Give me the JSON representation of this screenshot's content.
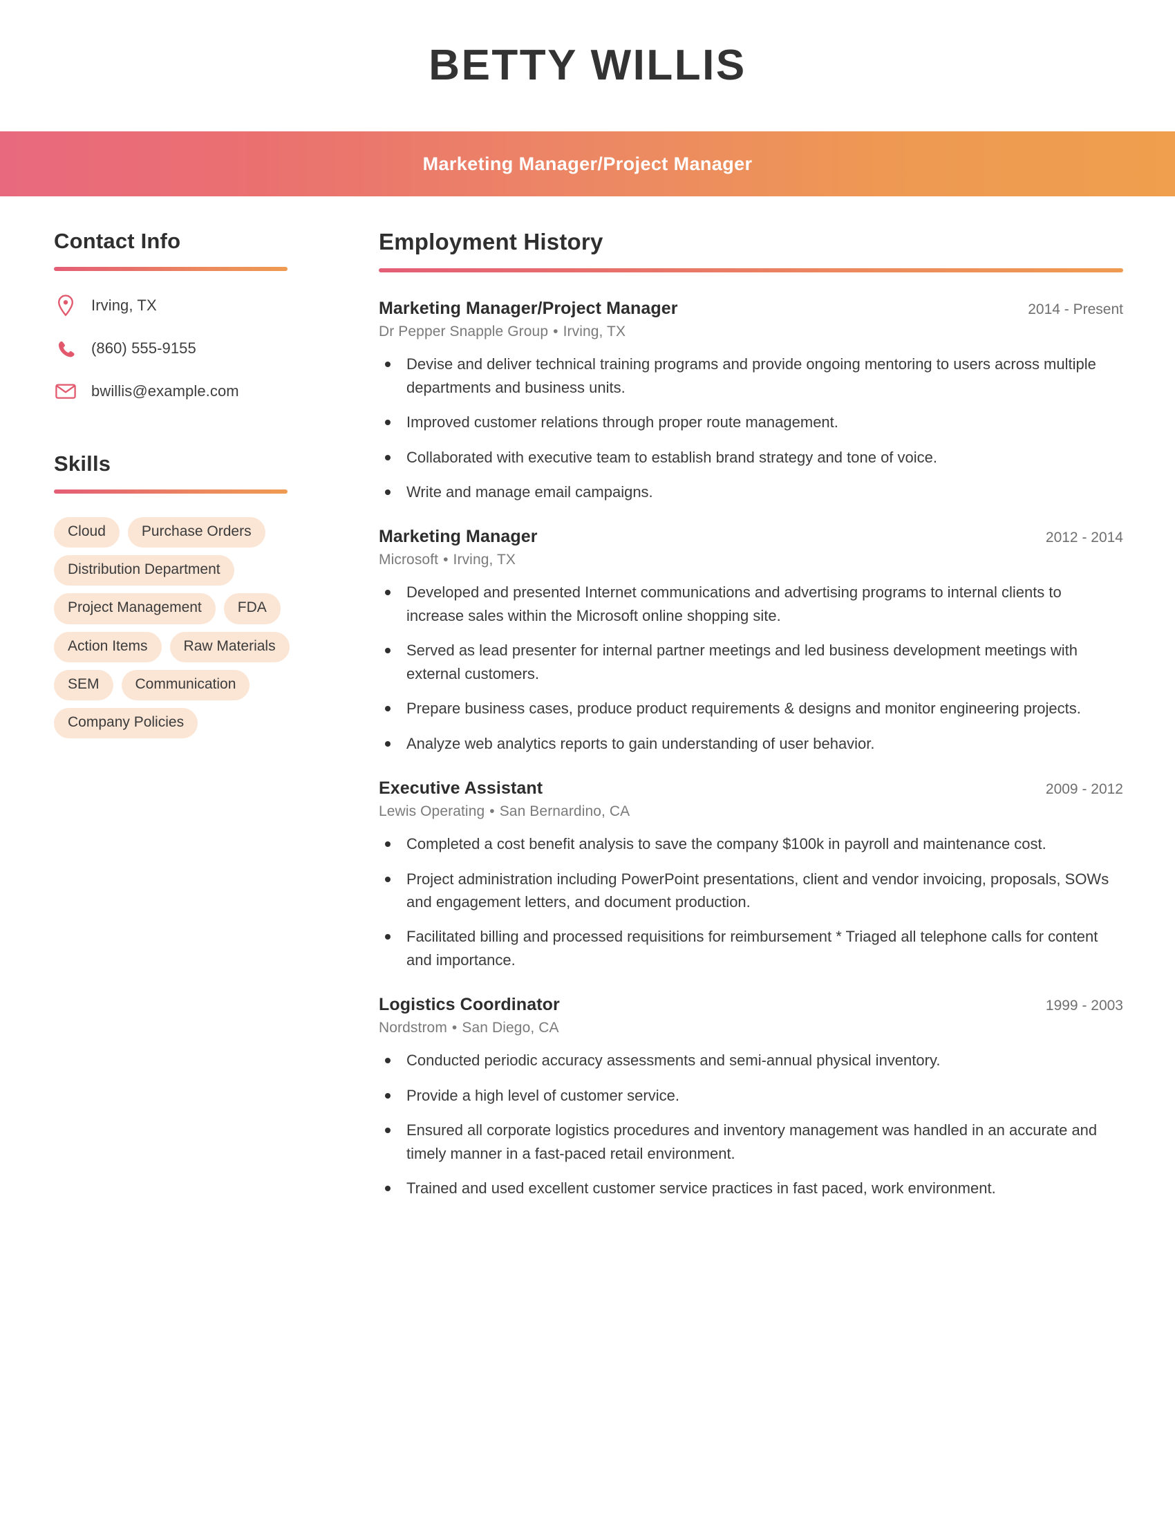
{
  "header": {
    "name": "BETTY WILLIS",
    "subtitle": "Marketing Manager/Project Manager",
    "gradient_start": "#E8697E",
    "gradient_end": "#EF9F4E",
    "name_color": "#333333",
    "subtitle_color": "#FFFFFF"
  },
  "sidebar": {
    "contact": {
      "heading": "Contact Info",
      "items": [
        {
          "icon": "location-pin-icon",
          "value": "Irving, TX"
        },
        {
          "icon": "phone-icon",
          "value": "(860) 555-9155"
        },
        {
          "icon": "envelope-icon",
          "value": "bwillis@example.com"
        }
      ]
    },
    "skills": {
      "heading": "Skills",
      "pill_bg": "#FBE5D5",
      "items": [
        "Cloud",
        "Purchase Orders",
        "Distribution Department",
        "Project Management",
        "FDA",
        "Action Items",
        "Raw Materials",
        "SEM",
        "Communication",
        "Company Policies"
      ]
    }
  },
  "main": {
    "heading": "Employment History",
    "jobs": [
      {
        "title": "Marketing Manager/Project Manager",
        "dates": "2014 - Present",
        "company": "Dr Pepper Snapple Group",
        "location": "Irving, TX",
        "bullets": [
          "Devise and deliver technical training programs and provide ongoing mentoring to users across multiple departments and business units.",
          "Improved customer relations through proper route management.",
          "Collaborated with executive team to establish brand strategy and tone of voice.",
          "Write and manage email campaigns."
        ]
      },
      {
        "title": "Marketing Manager",
        "dates": "2012 - 2014",
        "company": "Microsoft",
        "location": "Irving, TX",
        "bullets": [
          "Developed and presented Internet communications and advertising programs to internal clients to increase sales within the Microsoft online shopping site.",
          "Served as lead presenter for internal partner meetings and led business development meetings with external customers.",
          "Prepare business cases, produce product requirements & designs and monitor engineering projects.",
          "Analyze web analytics reports to gain understanding of user behavior."
        ]
      },
      {
        "title": "Executive Assistant",
        "dates": "2009 - 2012",
        "company": "Lewis Operating",
        "location": "San Bernardino, CA",
        "bullets": [
          "Completed a cost benefit analysis to save the company $100k in payroll and maintenance cost.",
          "Project administration including PowerPoint presentations, client and vendor invoicing, proposals, SOWs and engagement letters, and document production.",
          "Facilitated billing and processed requisitions for reimbursement * Triaged all telephone calls for content and importance."
        ]
      },
      {
        "title": "Logistics Coordinator",
        "dates": "1999 - 2003",
        "company": "Nordstrom",
        "location": "San Diego, CA",
        "bullets": [
          "Conducted periodic accuracy assessments and semi-annual physical inventory.",
          "Provide a high level of customer service.",
          "Ensured all corporate logistics procedures and inventory management was handled in an accurate and timely manner in a fast-paced retail environment.",
          "Trained and used excellent customer service practices in fast paced, work environment."
        ]
      }
    ],
    "separator_glyph": "•"
  },
  "theme": {
    "accent_pink": "#E45D76",
    "accent_orange": "#EE9B51",
    "icon_color": "#E2596D",
    "text_dark": "#3B3B3B",
    "text_muted": "#7A7A7A"
  }
}
